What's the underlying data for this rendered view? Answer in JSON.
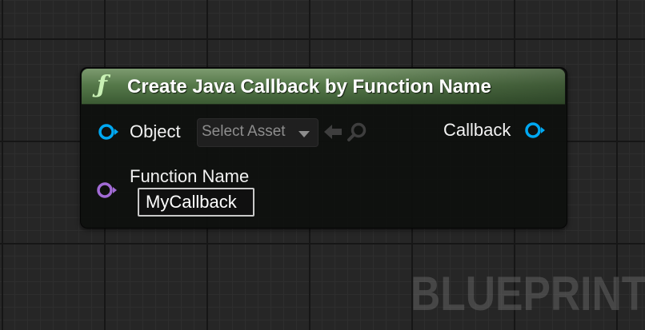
{
  "node": {
    "icon": "function-icon",
    "icon_glyph": "ƒ",
    "title": "Create Java Callback by Function Name",
    "header_color": "#56794a",
    "pins": {
      "object": {
        "label": "Object",
        "color": "#00a8f2",
        "asset_picker": {
          "label": "Select Asset",
          "icons": [
            "chevron-down-icon",
            "use-selected-arrow-icon",
            "browse-search-icon"
          ]
        }
      },
      "callback": {
        "label": "Callback",
        "color": "#00a8f2"
      },
      "function_name": {
        "label": "Function Name",
        "color": "#a26bd6",
        "value": "MyCallback"
      }
    }
  },
  "watermark": "BLUEPRINT"
}
